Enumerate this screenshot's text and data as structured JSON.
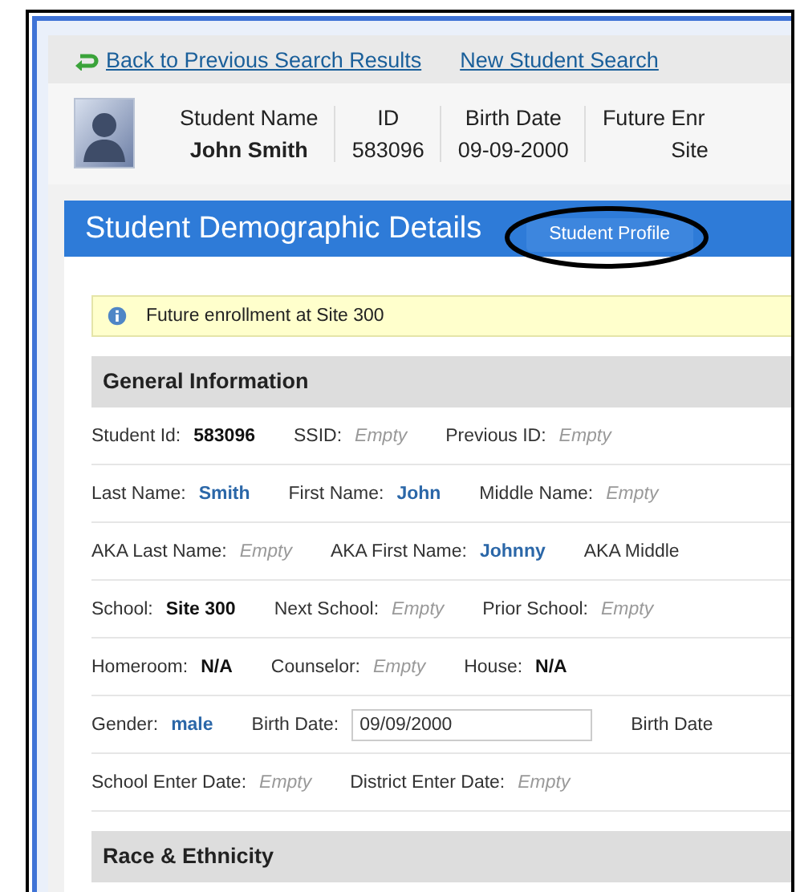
{
  "nav_links": [
    {
      "label": "Back to Previous Search Results",
      "kind": "back"
    },
    {
      "label": "New Student Search",
      "kind": "plain"
    }
  ],
  "student_header": [
    {
      "label": "Student Name",
      "value": "John Smith",
      "bold": true
    },
    {
      "label": "ID",
      "value": "583096",
      "bold": false
    },
    {
      "label": "Birth Date",
      "value": "09-09-2000",
      "bold": false
    },
    {
      "label": "Future Enr",
      "value": "Site",
      "bold": false
    }
  ],
  "panel": {
    "title": "Student Demographic Details",
    "profile_button": {
      "label": "Student Profile",
      "highlighted": true
    }
  },
  "notice": "Future enrollment at Site 300",
  "sections": [
    {
      "title": "General Information",
      "rows": [
        [
          {
            "label": "Student Id:",
            "value": "583096",
            "kind": "bold"
          },
          {
            "label": "SSID:",
            "value": "Empty",
            "kind": "empty"
          },
          {
            "label": "Previous ID:",
            "value": "Empty",
            "kind": "empty"
          }
        ],
        [
          {
            "label": "Last Name:",
            "value": "Smith",
            "kind": "link"
          },
          {
            "label": "First Name:",
            "value": "John",
            "kind": "link"
          },
          {
            "label": "Middle Name:",
            "value": "Empty",
            "kind": "empty"
          }
        ],
        [
          {
            "label": "AKA Last Name:",
            "value": "Empty",
            "kind": "empty"
          },
          {
            "label": "AKA First Name:",
            "value": "Johnny",
            "kind": "link"
          },
          {
            "label": "AKA Middle",
            "kind": "label"
          }
        ],
        [
          {
            "label": "School:",
            "value": "Site 300",
            "kind": "bold"
          },
          {
            "label": "Next School:",
            "value": "Empty",
            "kind": "empty"
          },
          {
            "label": "Prior School:",
            "value": "Empty",
            "kind": "empty"
          }
        ],
        [
          {
            "label": "Homeroom:",
            "value": "N/A",
            "kind": "bold"
          },
          {
            "label": "Counselor:",
            "value": "Empty",
            "kind": "empty"
          },
          {
            "label": "House:",
            "value": "N/A",
            "kind": "bold"
          }
        ],
        [
          {
            "label": "Gender:",
            "value": "male",
            "kind": "link"
          },
          {
            "label": "Birth Date:",
            "value": "09/09/2000",
            "kind": "input"
          },
          {
            "label": "Birth Date",
            "kind": "label"
          }
        ],
        [
          {
            "label": "School Enter Date:",
            "value": "Empty",
            "kind": "empty"
          },
          {
            "label": "District Enter Date:",
            "value": "Empty",
            "kind": "empty"
          }
        ]
      ]
    },
    {
      "title": "Race & Ethnicity"
    }
  ]
}
